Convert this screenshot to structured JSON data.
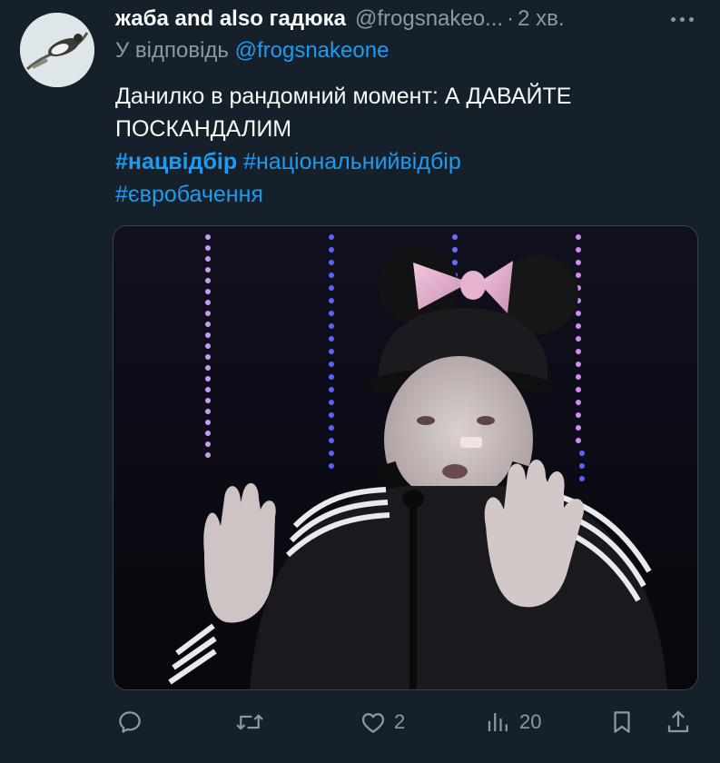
{
  "tweet": {
    "display_name": "жаба and also гадюка",
    "handle": "@frogsnakeo...",
    "separator": "·",
    "time": "2 хв.",
    "reply_prefix": "У відповідь",
    "reply_mention": "@frogsnakeone",
    "text": "Данилко в рандомний момент: А ДАВАЙТЕ ПОСКАНДАЛИМ",
    "hashtags": {
      "first": "#нацвідбір",
      "second": "#національнийвідбір",
      "third": "#євробачення"
    }
  },
  "actions": {
    "reply_count": "",
    "retweet_count": "",
    "like_count": "2",
    "views_count": "20"
  },
  "icons": {
    "more": "more-horizontal-icon",
    "reply": "comment-icon",
    "retweet": "retweet-icon",
    "like": "heart-icon",
    "views": "analytics-icon",
    "bookmark": "bookmark-icon",
    "share": "share-icon"
  },
  "colors": {
    "background": "#15202b",
    "text_primary": "#f7f9f9",
    "text_secondary": "#8b98a5",
    "accent": "#1d9bf0"
  }
}
